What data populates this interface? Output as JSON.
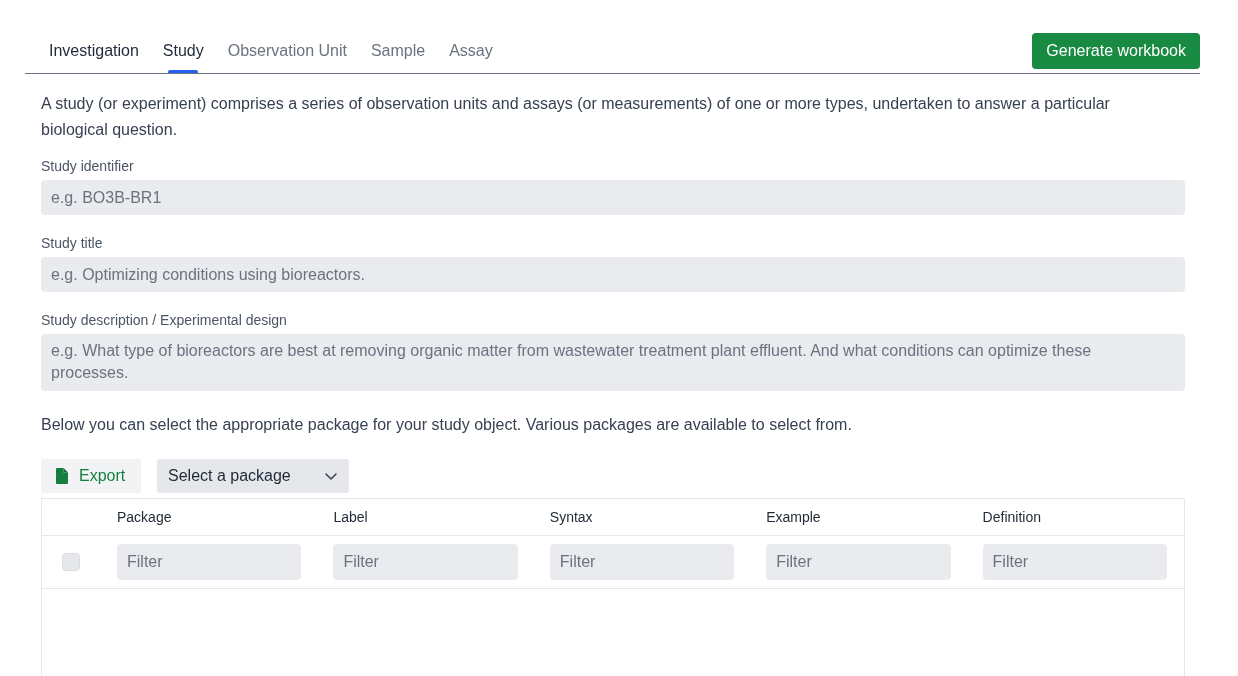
{
  "tabs": [
    {
      "label": "Investigation",
      "selected": false,
      "disabled": false
    },
    {
      "label": "Study",
      "selected": true,
      "disabled": false
    },
    {
      "label": "Observation Unit",
      "selected": false,
      "disabled": true
    },
    {
      "label": "Sample",
      "selected": false,
      "disabled": true
    },
    {
      "label": "Assay",
      "selected": false,
      "disabled": true
    }
  ],
  "generate_button": "Generate workbook",
  "intro": "A study (or experiment) comprises a series of observation units and assays (or measurements) of one or more types, undertaken to answer a particular biological question.",
  "fields": [
    {
      "kind": "input",
      "label": "Study identifier",
      "placeholder": "e.g. BO3B-BR1"
    },
    {
      "kind": "input",
      "label": "Study title",
      "placeholder": "e.g. Optimizing conditions using bioreactors."
    },
    {
      "kind": "textarea",
      "label": "Study description / Experimental design",
      "placeholder": "e.g. What type of bioreactors are best at removing organic matter from wastewater treatment plant effluent. And what conditions can optimize these processes."
    }
  ],
  "package_note": "Below you can select the appropriate package for your study object. Various packages are available to select from.",
  "toolbar": {
    "export_button": "Export",
    "package_dropdown": "Select a package"
  },
  "table": {
    "columns": [
      "Package",
      "Label",
      "Syntax",
      "Example",
      "Definition"
    ],
    "filter_row": {
      "checked": false,
      "filters": [
        {
          "placeholder": "Filter"
        },
        {
          "placeholder": "Filter"
        },
        {
          "placeholder": "Filter"
        },
        {
          "placeholder": "Filter"
        },
        {
          "placeholder": "Filter"
        }
      ]
    }
  }
}
